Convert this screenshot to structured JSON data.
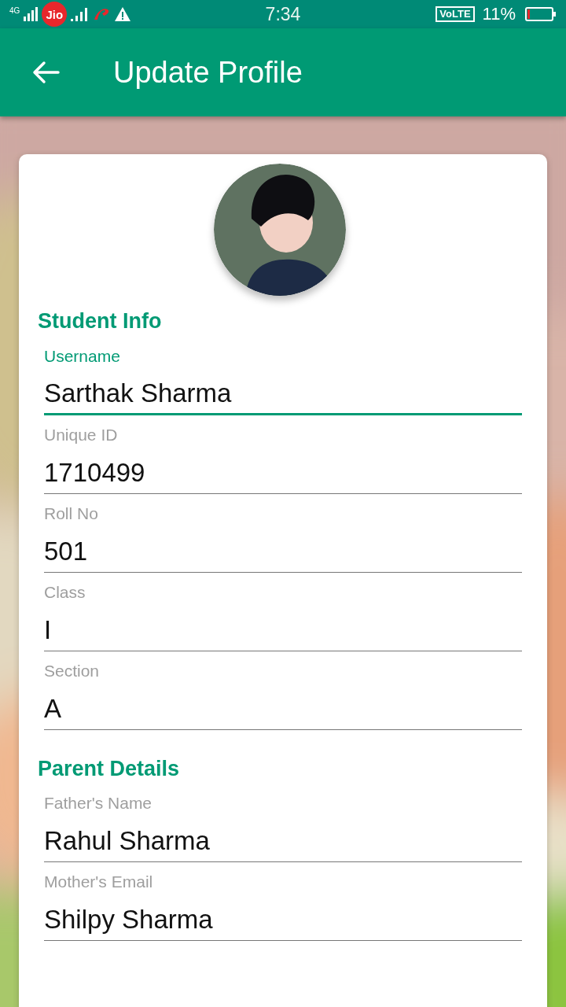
{
  "status_bar": {
    "network_1": "4G",
    "carrier_badge": "Jio",
    "time": "7:34",
    "volte": "VoLTE",
    "battery": "11%"
  },
  "app_bar": {
    "title": "Update Profile"
  },
  "sections": [
    {
      "title": "Student Info",
      "fields": [
        {
          "label": "Username",
          "value": "Sarthak Sharma",
          "focused": true
        },
        {
          "label": "Unique ID",
          "value": "1710499",
          "focused": false
        },
        {
          "label": "Roll No",
          "value": "501",
          "focused": false
        },
        {
          "label": "Class",
          "value": "I",
          "focused": false
        },
        {
          "label": "Section",
          "value": "A",
          "focused": false
        }
      ]
    },
    {
      "title": "Parent Details",
      "fields": [
        {
          "label": "Father's Name",
          "value": "Rahul Sharma",
          "focused": false
        },
        {
          "label": "Mother's Email",
          "value": "Shilpy Sharma",
          "focused": false
        }
      ]
    }
  ]
}
